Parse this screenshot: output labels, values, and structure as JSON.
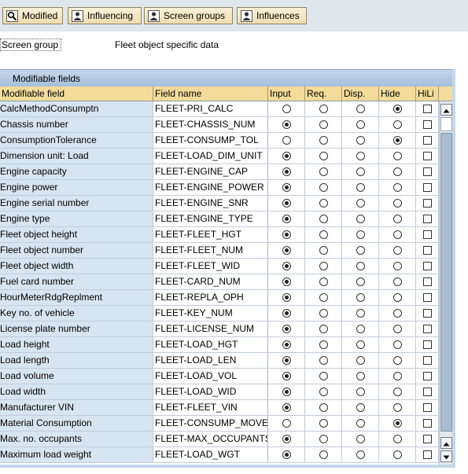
{
  "toolbar": {
    "buttons": [
      {
        "label": "Modified",
        "icon": "search-settings-icon"
      },
      {
        "label": "Influencing",
        "icon": "person-icon"
      },
      {
        "label": "Screen groups",
        "icon": "person-icon"
      },
      {
        "label": "Influences",
        "icon": "person-icon"
      }
    ]
  },
  "screen_group": {
    "label": "Screen group",
    "value": "Fleet object specific data"
  },
  "grid": {
    "title": "Modifiable fields",
    "columns": [
      "Modifiable field",
      "Field name",
      "Input",
      "Req.",
      "Disp.",
      "Hide",
      "HiLi"
    ],
    "rows": [
      {
        "field": "CalcMethodConsumptn",
        "name": "FLEET-PRI_CALC",
        "sel": "hide"
      },
      {
        "field": "Chassis number",
        "name": "FLEET-CHASSIS_NUM",
        "sel": "input"
      },
      {
        "field": "ConsumptionTolerance",
        "name": "FLEET-CONSUMP_TOL",
        "sel": "hide"
      },
      {
        "field": "Dimension unit: Load",
        "name": "FLEET-LOAD_DIM_UNIT",
        "sel": "input"
      },
      {
        "field": "Engine capacity",
        "name": "FLEET-ENGINE_CAP",
        "sel": "input"
      },
      {
        "field": "Engine power",
        "name": "FLEET-ENGINE_POWER",
        "sel": "input"
      },
      {
        "field": "Engine serial number",
        "name": "FLEET-ENGINE_SNR",
        "sel": "input"
      },
      {
        "field": "Engine type",
        "name": "FLEET-ENGINE_TYPE",
        "sel": "input"
      },
      {
        "field": "Fleet object height",
        "name": "FLEET-FLEET_HGT",
        "sel": "input"
      },
      {
        "field": "Fleet object number",
        "name": "FLEET-FLEET_NUM",
        "sel": "input"
      },
      {
        "field": "Fleet object width",
        "name": "FLEET-FLEET_WID",
        "sel": "input"
      },
      {
        "field": "Fuel card number",
        "name": "FLEET-CARD_NUM",
        "sel": "input"
      },
      {
        "field": "HourMeterRdgReplment",
        "name": "FLEET-REPLA_OPH",
        "sel": "input"
      },
      {
        "field": "Key no. of vehicle",
        "name": "FLEET-KEY_NUM",
        "sel": "input"
      },
      {
        "field": "License plate number",
        "name": "FLEET-LICENSE_NUM",
        "sel": "input"
      },
      {
        "field": "Load height",
        "name": "FLEET-LOAD_HGT",
        "sel": "input"
      },
      {
        "field": "Load length",
        "name": "FLEET-LOAD_LEN",
        "sel": "input"
      },
      {
        "field": "Load volume",
        "name": "FLEET-LOAD_VOL",
        "sel": "input"
      },
      {
        "field": "Load width",
        "name": "FLEET-LOAD_WID",
        "sel": "input"
      },
      {
        "field": "Manufacturer VIN",
        "name": "FLEET-FLEET_VIN",
        "sel": "input"
      },
      {
        "field": "Material Consumption",
        "name": "FLEET-CONSUMP_MOVE",
        "sel": "hide"
      },
      {
        "field": "Max. no. occupants",
        "name": "FLEET-MAX_OCCUPANTS",
        "sel": "input"
      },
      {
        "field": "Maximum load weight",
        "name": "FLEET-LOAD_WGT",
        "sel": "input"
      }
    ]
  },
  "colors": {
    "toolbar_bg": "#dfe6ec",
    "header_bg": "#f3dc9a",
    "field_col_bg": "#d7e4f1",
    "title_bar": "#a6bfdc"
  }
}
